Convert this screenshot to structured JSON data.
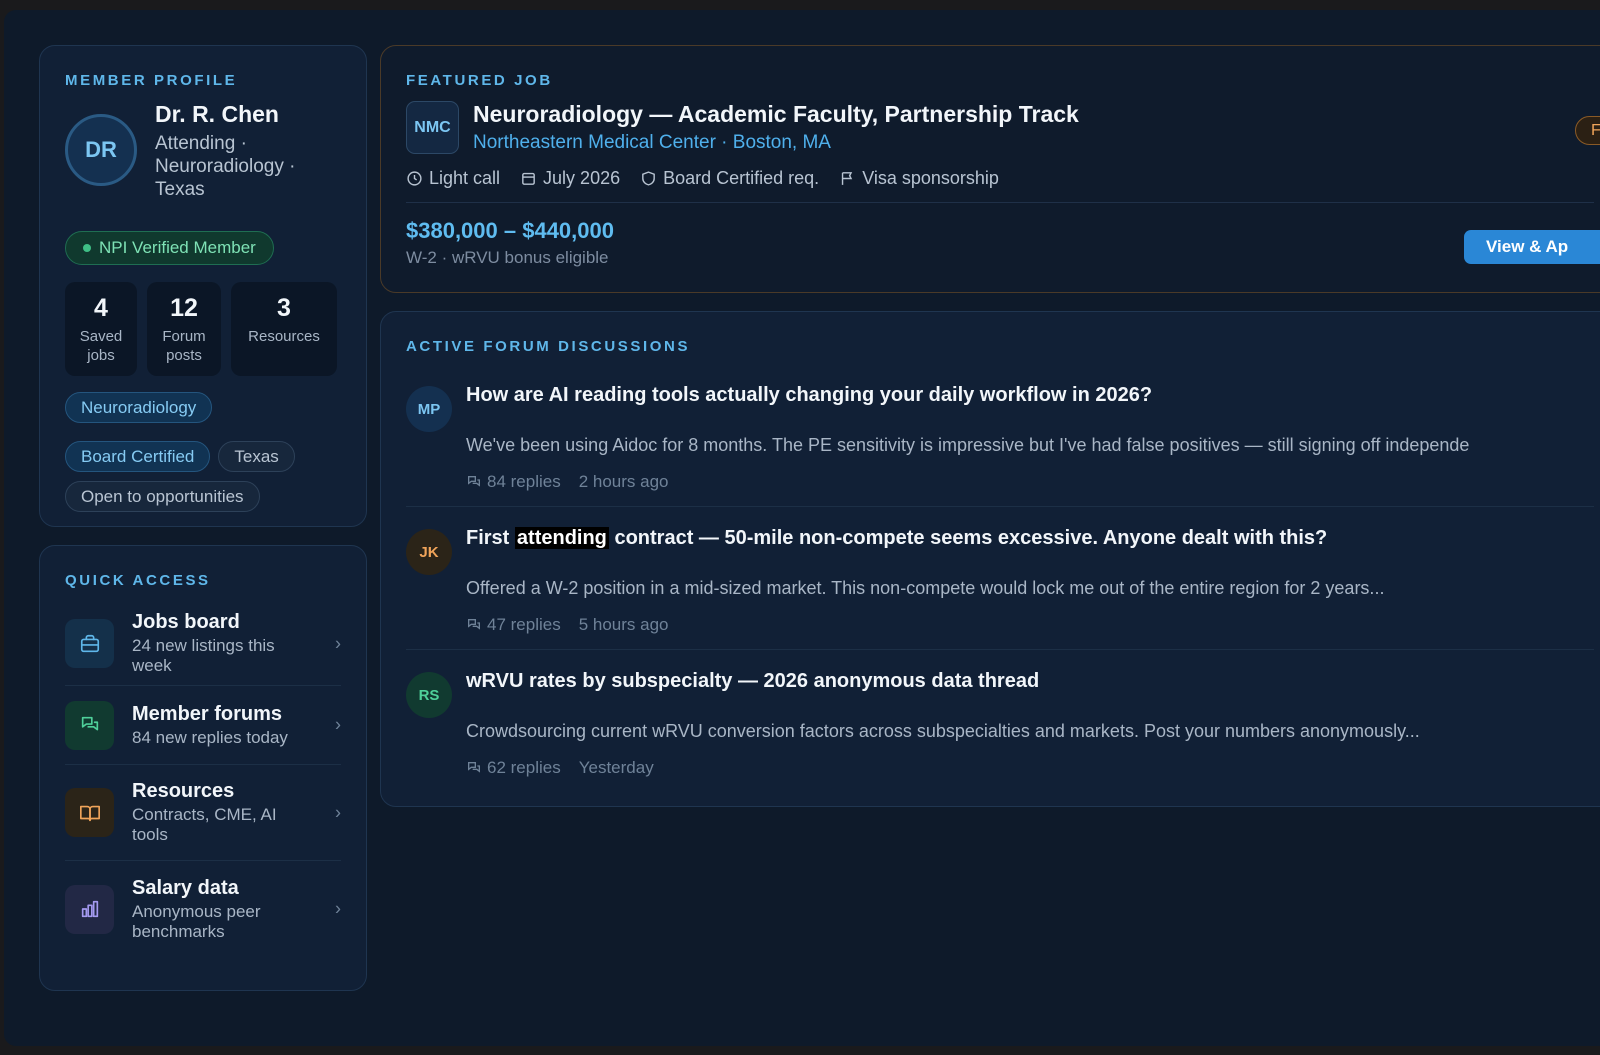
{
  "profile": {
    "section_label": "MEMBER PROFILE",
    "initials": "DR",
    "name": "Dr. R. Chen",
    "role": "Attending · Neuroradiology · Texas",
    "verified_label": "NPI Verified Member",
    "stats": [
      {
        "value": "4",
        "label": "Saved jobs"
      },
      {
        "value": "12",
        "label": "Forum posts"
      },
      {
        "value": "3",
        "label": "Resources"
      }
    ],
    "tags": [
      "Neuroradiology",
      "Board Certified",
      "Texas",
      "Open to opportunities"
    ]
  },
  "quick_access": {
    "section_label": "QUICK ACCESS",
    "items": [
      {
        "title": "Jobs board",
        "subtitle": "24 new listings this week",
        "icon": "briefcase-icon"
      },
      {
        "title": "Member forums",
        "subtitle": "84 new replies today",
        "icon": "chat-icon"
      },
      {
        "title": "Resources",
        "subtitle": "Contracts, CME, AI tools",
        "icon": "book-icon"
      },
      {
        "title": "Salary data",
        "subtitle": "Anonymous peer benchmarks",
        "icon": "bar-chart-icon"
      }
    ]
  },
  "featured_job": {
    "section_label": "FEATURED JOB",
    "logo_text": "NMC",
    "title": "Neuroradiology — Academic Faculty, Partnership Track",
    "org": "Northeastern Medical Center · Boston, MA",
    "pill": "Feat",
    "meta": [
      "Light call",
      "July 2026",
      "Board Certified req.",
      "Visa sponsorship"
    ],
    "salary": "$380,000 – $440,000",
    "salary_sub": "W-2 · wRVU bonus eligible",
    "apply_label": "View & Ap"
  },
  "forum": {
    "section_label": "ACTIVE FORUM DISCUSSIONS",
    "threads": [
      {
        "initials": "MP",
        "title": "How are AI reading tools actually changing your daily workflow in 2026?",
        "body": "We've been using Aidoc for 8 months. The PE sensitivity is impressive but I've had false positives — still signing off independe",
        "replies": "84 replies",
        "time": "2 hours ago"
      },
      {
        "initials": "JK",
        "title_pre": "First ",
        "title_hl": "attending",
        "title_post": " contract — 50-mile non-compete seems excessive. Anyone dealt with this?",
        "body": "Offered a W-2 position in a mid-sized market. This non-compete would lock me out of the entire region for 2 years...",
        "replies": "47 replies",
        "time": "5 hours ago"
      },
      {
        "initials": "RS",
        "title": "wRVU rates by subspecialty — 2026 anonymous data thread",
        "body": "Crowdsourcing current wRVU conversion factors across subspecialties and markets. Post your numbers anonymously...",
        "replies": "62 replies",
        "time": "Yesterday"
      }
    ]
  },
  "colors": {
    "accent": "#5fb7ea",
    "apply_button": "#2a87d6",
    "verified": "#7ee2b5",
    "featured_border": "#4a3a28"
  }
}
